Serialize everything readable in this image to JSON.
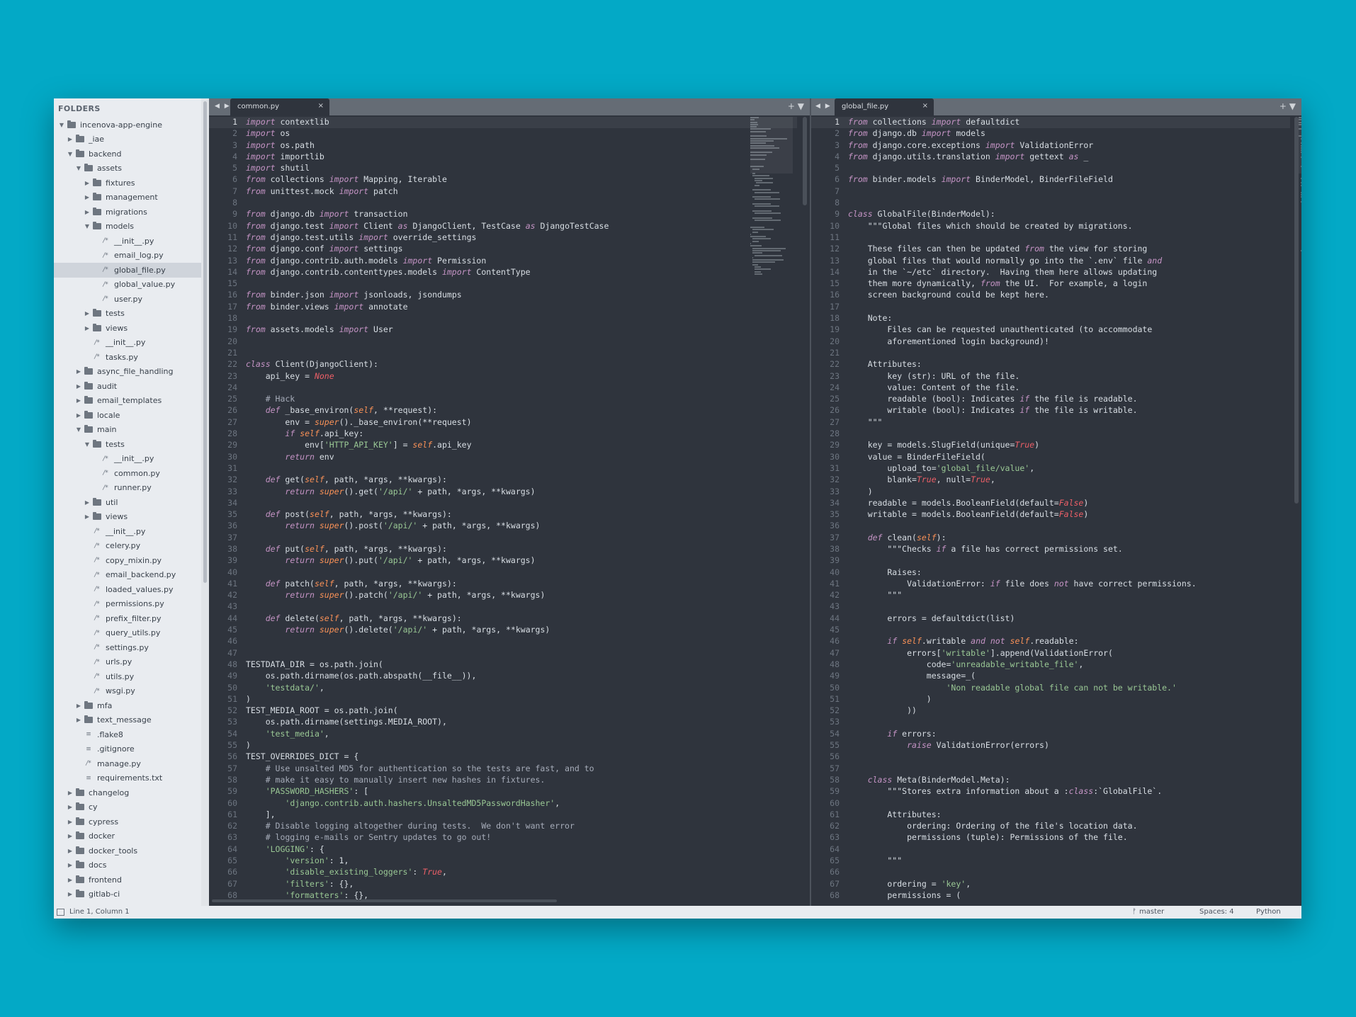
{
  "sidebar": {
    "header": "FOLDERS",
    "items": [
      {
        "label": "incenova-app-engine",
        "type": "folder",
        "depth": 0,
        "open": true
      },
      {
        "label": "_iae",
        "type": "folder",
        "depth": 1,
        "open": false
      },
      {
        "label": "backend",
        "type": "folder",
        "depth": 1,
        "open": true
      },
      {
        "label": "assets",
        "type": "folder",
        "depth": 2,
        "open": true
      },
      {
        "label": "fixtures",
        "type": "folder",
        "depth": 3,
        "open": false
      },
      {
        "label": "management",
        "type": "folder",
        "depth": 3,
        "open": false
      },
      {
        "label": "migrations",
        "type": "folder",
        "depth": 3,
        "open": false
      },
      {
        "label": "models",
        "type": "folder",
        "depth": 3,
        "open": true
      },
      {
        "label": "__init__.py",
        "type": "file",
        "depth": 4
      },
      {
        "label": "email_log.py",
        "type": "file",
        "depth": 4
      },
      {
        "label": "global_file.py",
        "type": "file",
        "depth": 4,
        "selected": true
      },
      {
        "label": "global_value.py",
        "type": "file",
        "depth": 4
      },
      {
        "label": "user.py",
        "type": "file",
        "depth": 4
      },
      {
        "label": "tests",
        "type": "folder",
        "depth": 3,
        "open": false
      },
      {
        "label": "views",
        "type": "folder",
        "depth": 3,
        "open": false
      },
      {
        "label": "__init__.py",
        "type": "file",
        "depth": 3
      },
      {
        "label": "tasks.py",
        "type": "file",
        "depth": 3
      },
      {
        "label": "async_file_handling",
        "type": "folder",
        "depth": 2,
        "open": false
      },
      {
        "label": "audit",
        "type": "folder",
        "depth": 2,
        "open": false
      },
      {
        "label": "email_templates",
        "type": "folder",
        "depth": 2,
        "open": false
      },
      {
        "label": "locale",
        "type": "folder",
        "depth": 2,
        "open": false
      },
      {
        "label": "main",
        "type": "folder",
        "depth": 2,
        "open": true
      },
      {
        "label": "tests",
        "type": "folder",
        "depth": 3,
        "open": true
      },
      {
        "label": "__init__.py",
        "type": "file",
        "depth": 4
      },
      {
        "label": "common.py",
        "type": "file",
        "depth": 4
      },
      {
        "label": "runner.py",
        "type": "file",
        "depth": 4
      },
      {
        "label": "util",
        "type": "folder",
        "depth": 3,
        "open": false
      },
      {
        "label": "views",
        "type": "folder",
        "depth": 3,
        "open": false
      },
      {
        "label": "__init__.py",
        "type": "file",
        "depth": 3
      },
      {
        "label": "celery.py",
        "type": "file",
        "depth": 3
      },
      {
        "label": "copy_mixin.py",
        "type": "file",
        "depth": 3
      },
      {
        "label": "email_backend.py",
        "type": "file",
        "depth": 3
      },
      {
        "label": "loaded_values.py",
        "type": "file",
        "depth": 3
      },
      {
        "label": "permissions.py",
        "type": "file",
        "depth": 3
      },
      {
        "label": "prefix_filter.py",
        "type": "file",
        "depth": 3
      },
      {
        "label": "query_utils.py",
        "type": "file",
        "depth": 3
      },
      {
        "label": "settings.py",
        "type": "file",
        "depth": 3
      },
      {
        "label": "urls.py",
        "type": "file",
        "depth": 3
      },
      {
        "label": "utils.py",
        "type": "file",
        "depth": 3
      },
      {
        "label": "wsgi.py",
        "type": "file",
        "depth": 3
      },
      {
        "label": "mfa",
        "type": "folder",
        "depth": 2,
        "open": false
      },
      {
        "label": "text_message",
        "type": "folder",
        "depth": 2,
        "open": false
      },
      {
        "label": ".flake8",
        "type": "plain",
        "depth": 2
      },
      {
        "label": ".gitignore",
        "type": "plain",
        "depth": 2
      },
      {
        "label": "manage.py",
        "type": "file",
        "depth": 2
      },
      {
        "label": "requirements.txt",
        "type": "plain",
        "depth": 2
      },
      {
        "label": "changelog",
        "type": "folder",
        "depth": 1,
        "open": false
      },
      {
        "label": "cy",
        "type": "folder",
        "depth": 1,
        "open": false
      },
      {
        "label": "cypress",
        "type": "folder",
        "depth": 1,
        "open": false
      },
      {
        "label": "docker",
        "type": "folder",
        "depth": 1,
        "open": false
      },
      {
        "label": "docker_tools",
        "type": "folder",
        "depth": 1,
        "open": false
      },
      {
        "label": "docs",
        "type": "folder",
        "depth": 1,
        "open": false
      },
      {
        "label": "frontend",
        "type": "folder",
        "depth": 1,
        "open": false
      },
      {
        "label": "gitlab-ci",
        "type": "folder",
        "depth": 1,
        "open": false
      }
    ]
  },
  "left_pane": {
    "tab": "common.py",
    "lines": [
      "import contextlib",
      "import os",
      "import os.path",
      "import importlib",
      "import shutil",
      "from collections import Mapping, Iterable",
      "from unittest.mock import patch",
      "",
      "from django.db import transaction",
      "from django.test import Client as DjangoClient, TestCase as DjangoTestCase",
      "from django.test.utils import override_settings",
      "from django.conf import settings",
      "from django.contrib.auth.models import Permission",
      "from django.contrib.contenttypes.models import ContentType",
      "",
      "from binder.json import jsonloads, jsondumps",
      "from binder.views import annotate",
      "",
      "from assets.models import User",
      "",
      "",
      "class Client(DjangoClient):",
      "    api_key = None",
      "",
      "    # Hack",
      "    def _base_environ(self, **request):",
      "        env = super()._base_environ(**request)",
      "        if self.api_key:",
      "            env['HTTP_API_KEY'] = self.api_key",
      "        return env",
      "",
      "    def get(self, path, *args, **kwargs):",
      "        return super().get('/api/' + path, *args, **kwargs)",
      "",
      "    def post(self, path, *args, **kwargs):",
      "        return super().post('/api/' + path, *args, **kwargs)",
      "",
      "    def put(self, path, *args, **kwargs):",
      "        return super().put('/api/' + path, *args, **kwargs)",
      "",
      "    def patch(self, path, *args, **kwargs):",
      "        return super().patch('/api/' + path, *args, **kwargs)",
      "",
      "    def delete(self, path, *args, **kwargs):",
      "        return super().delete('/api/' + path, *args, **kwargs)",
      "",
      "",
      "TESTDATA_DIR = os.path.join(",
      "    os.path.dirname(os.path.abspath(__file__)),",
      "    'testdata/',",
      ")",
      "TEST_MEDIA_ROOT = os.path.join(",
      "    os.path.dirname(settings.MEDIA_ROOT),",
      "    'test_media',",
      ")",
      "TEST_OVERRIDES_DICT = {",
      "    # Use unsalted MD5 for authentication so the tests are fast, and to",
      "    # make it easy to manually insert new hashes in fixtures.",
      "    'PASSWORD_HASHERS': [",
      "        'django.contrib.auth.hashers.UnsaltedMD5PasswordHasher',",
      "    ],",
      "    # Disable logging altogether during tests.  We don't want error",
      "    # logging e-mails or Sentry updates to go out!",
      "    'LOGGING': {",
      "        'version': 1,",
      "        'disable_existing_loggers': True,",
      "        'filters': {},",
      "        'formatters': {},"
    ]
  },
  "right_pane": {
    "tab": "global_file.py",
    "lines": [
      "from collections import defaultdict",
      "from django.db import models",
      "from django.core.exceptions import ValidationError",
      "from django.utils.translation import gettext as _",
      "",
      "from binder.models import BinderModel, BinderFileField",
      "",
      "",
      "class GlobalFile(BinderModel):",
      "    \"\"\"Global files which should be created by migrations.",
      "",
      "    These files can then be updated from the view for storing",
      "    global files that would normally go into the `.env` file and",
      "    in the `~/etc` directory.  Having them here allows updating",
      "    them more dynamically, from the UI.  For example, a login",
      "    screen background could be kept here.",
      "",
      "    Note:",
      "        Files can be requested unauthenticated (to accommodate",
      "        aforementioned login background)!",
      "",
      "    Attributes:",
      "        key (str): URL of the file.",
      "        value: Content of the file.",
      "        readable (bool): Indicates if the file is readable.",
      "        writable (bool): Indicates if the file is writable.",
      "    \"\"\"",
      "",
      "    key = models.SlugField(unique=True)",
      "    value = BinderFileField(",
      "        upload_to='global_file/value',",
      "        blank=True, null=True,",
      "    )",
      "    readable = models.BooleanField(default=False)",
      "    writable = models.BooleanField(default=False)",
      "",
      "    def clean(self):",
      "        \"\"\"Checks if a file has correct permissions set.",
      "",
      "        Raises:",
      "            ValidationError: if file does not have correct permissions.",
      "        \"\"\"",
      "",
      "        errors = defaultdict(list)",
      "",
      "        if self.writable and not self.readable:",
      "            errors['writable'].append(ValidationError(",
      "                code='unreadable_writable_file',",
      "                message=_(",
      "                    'Non readable global file can not be writable.'",
      "                )",
      "            ))",
      "",
      "        if errors:",
      "            raise ValidationError(errors)",
      "",
      "",
      "    class Meta(BinderModel.Meta):",
      "        \"\"\"Stores extra information about a :class:`GlobalFile`.",
      "",
      "        Attributes:",
      "            ordering: Ordering of the file's location data.",
      "            permissions (tuple): Permissions of the file.",
      "",
      "        \"\"\"",
      "",
      "        ordering = 'key',",
      "        permissions = ("
    ]
  },
  "statusbar": {
    "position": "Line 1, Column 1",
    "branch": "master",
    "indent": "Spaces: 4",
    "syntax": "Python"
  },
  "icons": {
    "tab_close": "×",
    "nav": "◀ ▶",
    "tools": "+ ▼",
    "folder_open": "▼",
    "folder_closed": "▶",
    "file": "/*",
    "plain_file": "≡",
    "branch": "ᚠ"
  },
  "colors": {
    "background": "#03a9c6",
    "editor_bg": "#2f343d",
    "sidebar_bg": "#e9ecf0",
    "keyword": "#c594c5",
    "string": "#99c794",
    "builtin": "#6699cc",
    "classname": "#f99157",
    "comment": "#a6acb9",
    "constant": "#ec5f67"
  }
}
